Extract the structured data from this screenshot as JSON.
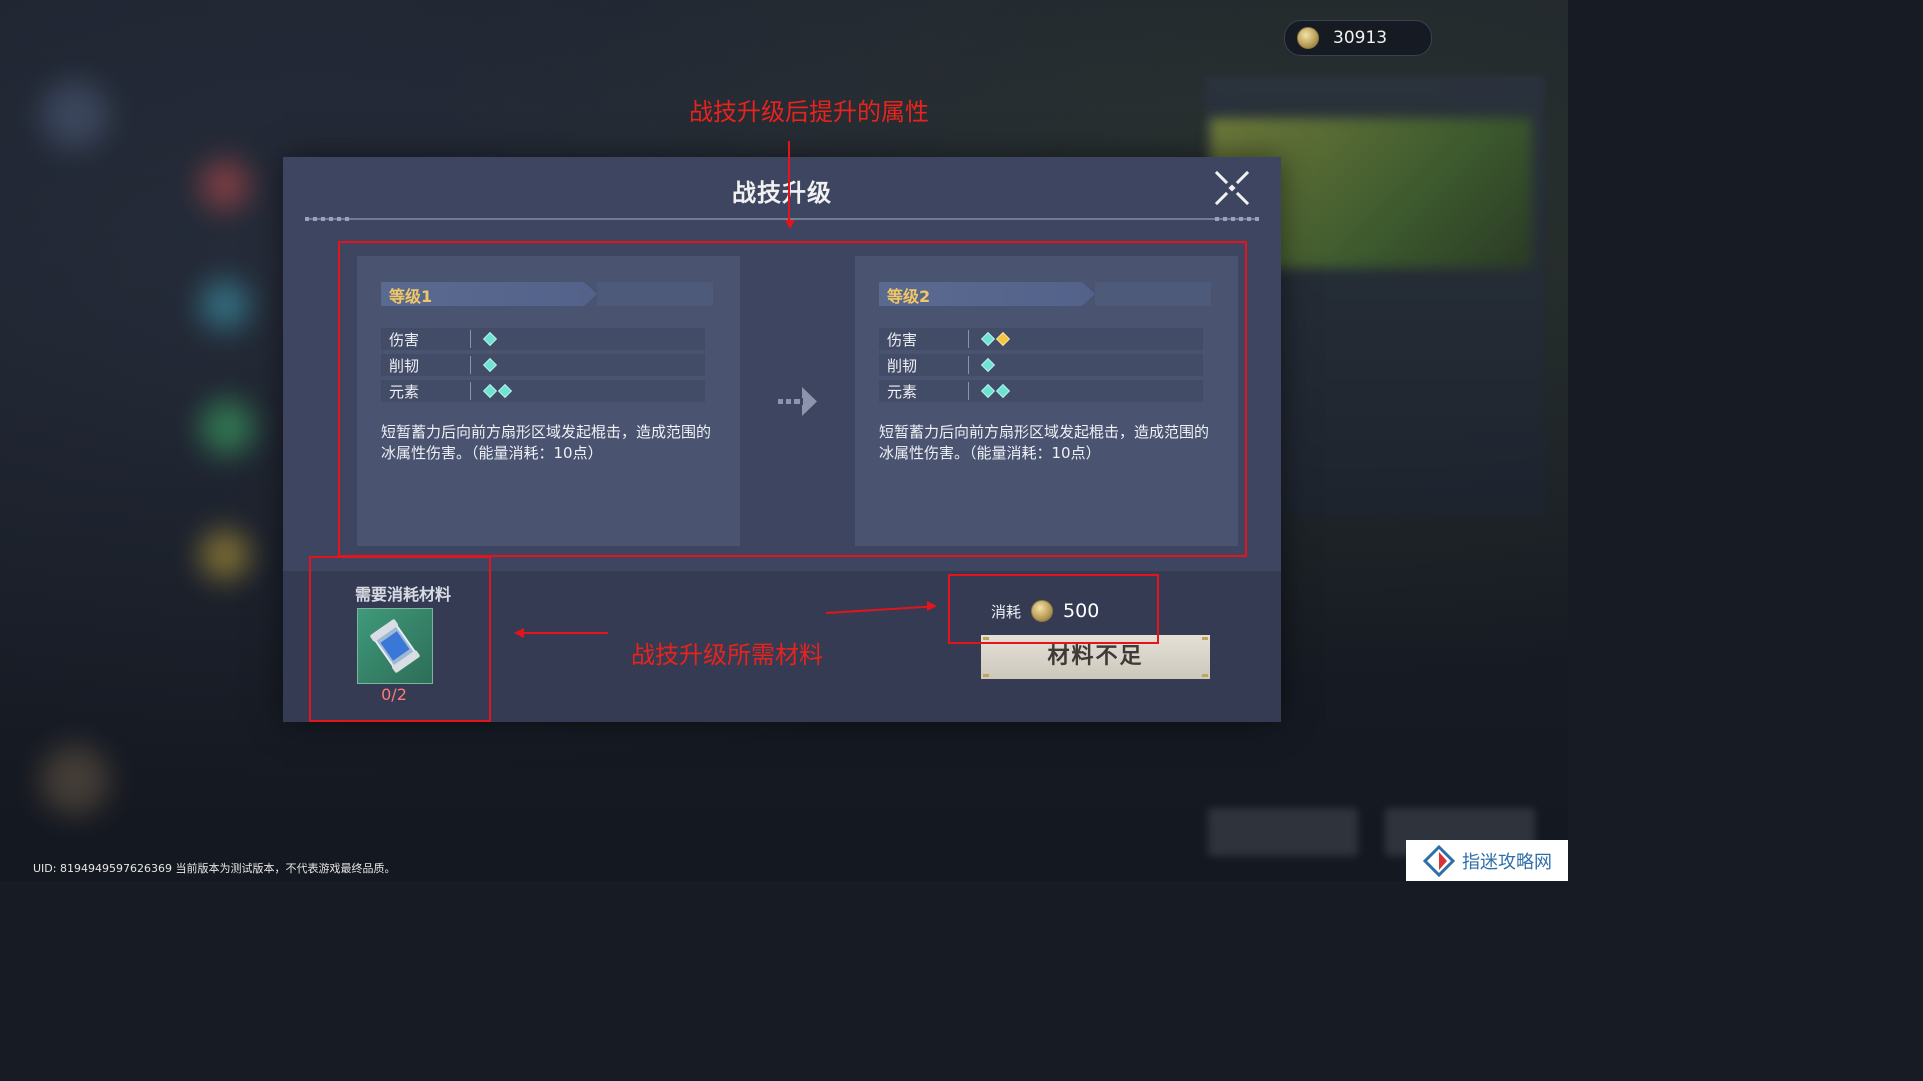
{
  "currency": {
    "amount": "30913",
    "icon": "gold-coin-icon"
  },
  "annotations": {
    "top": "战技升级后提升的属性",
    "bottom": "战技升级所需材料"
  },
  "dialog": {
    "title": "战技升级",
    "close_icon": "close-icon",
    "levels": [
      {
        "tag": "等级1",
        "stats": [
          {
            "label": "伤害",
            "gems": [
              "cyan"
            ]
          },
          {
            "label": "削韧",
            "gems": [
              "cyan"
            ]
          },
          {
            "label": "元素",
            "gems": [
              "cyan",
              "cyan"
            ]
          }
        ],
        "description": "短暂蓄力后向前方扇形区域发起棍击，造成范围的冰属性伤害。（能量消耗：10点）"
      },
      {
        "tag": "等级2",
        "stats": [
          {
            "label": "伤害",
            "gems": [
              "cyan",
              "gold"
            ]
          },
          {
            "label": "削韧",
            "gems": [
              "cyan"
            ]
          },
          {
            "label": "元素",
            "gems": [
              "cyan",
              "cyan"
            ]
          }
        ],
        "description": "短暂蓄力后向前方扇形区域发起棍击，造成范围的冰属性伤害。（能量消耗：10点）"
      }
    ],
    "materials": {
      "title": "需要消耗材料",
      "item_icon": "material-capsule-icon",
      "count": "0/2"
    },
    "cost": {
      "label": "消耗",
      "value": "500"
    },
    "upgrade_button": "材料不足"
  },
  "footer": {
    "uid": "UID: 8194949597626369 当前版本为测试版本，不代表游戏最终品质。",
    "watermark": "指迷攻略网"
  },
  "colors": {
    "annotation_red": "#e3141b",
    "gem_cyan": "#6fe3d3",
    "gem_gold": "#f3c640",
    "level_tag_gold": "#f0c766",
    "insufficient_red": "#ff7a7a"
  }
}
